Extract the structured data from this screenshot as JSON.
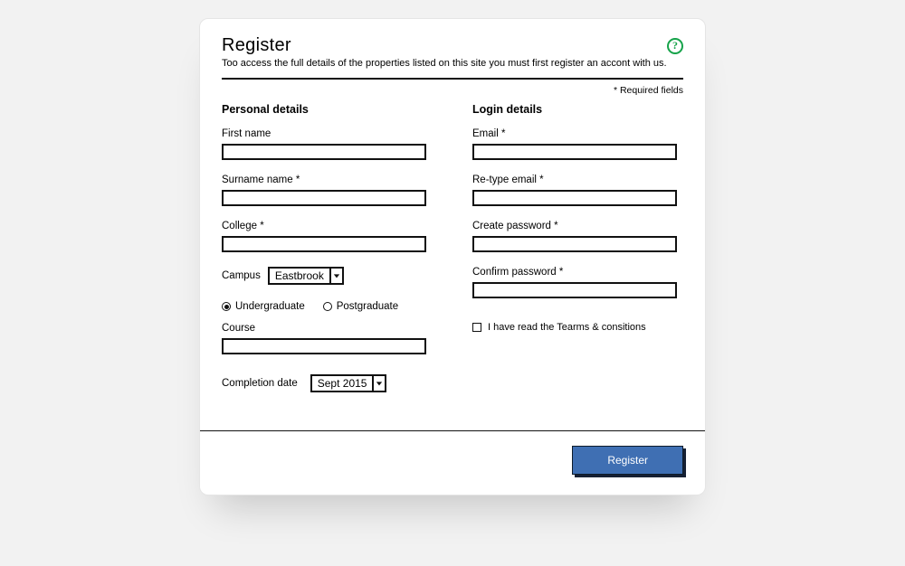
{
  "header": {
    "title": "Register",
    "subtitle": "Too access the full details of the properties listed on this site you must first register an accont with us.",
    "help_glyph": "?"
  },
  "required_note": "* Required fields",
  "personal": {
    "heading": "Personal details",
    "first_name_label": "First name",
    "surname_label": "Surname name *",
    "college_label": "College *",
    "campus_label": "Campus",
    "campus_value": "Eastbrook",
    "level_undergrad": "Undergraduate",
    "level_postgrad": "Postgraduate",
    "course_label": "Course",
    "completion_label": "Completion date",
    "completion_value": "Sept 2015"
  },
  "login": {
    "heading": "Login details",
    "email_label": "Email *",
    "retype_email_label": "Re-type email *",
    "create_password_label": "Create password *",
    "confirm_password_label": "Confirm password *",
    "terms_label": "I have read the Tearms & consitions"
  },
  "footer": {
    "register_label": "Register"
  }
}
